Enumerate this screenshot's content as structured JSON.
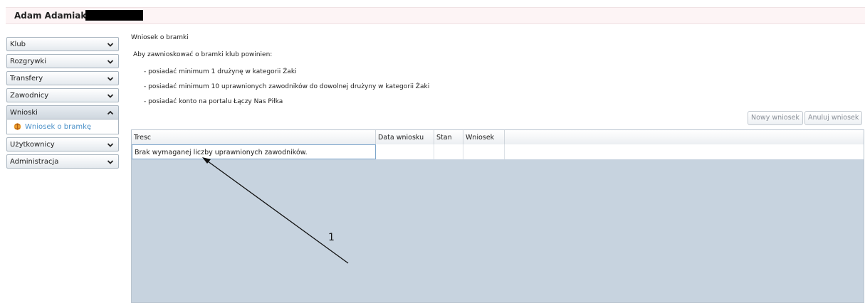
{
  "header": {
    "user_name": "Adam Adamiak,"
  },
  "menu": {
    "items": [
      {
        "label": "Klub",
        "icon": "chevron-down-icon"
      },
      {
        "label": "Rozgrywki",
        "icon": "chevron-down-icon"
      },
      {
        "label": "Transfery",
        "icon": "chevron-down-icon"
      },
      {
        "label": "Zawodnicy",
        "icon": "chevron-down-icon"
      },
      {
        "label": "Wnioski",
        "icon": "chevron-up-icon"
      },
      {
        "label": "Użytkownicy",
        "icon": "chevron-down-icon"
      },
      {
        "label": "Administracja",
        "icon": "chevron-down-icon"
      }
    ],
    "submenu": {
      "label": "Wniosek o bramkę",
      "icon": "goal-icon"
    }
  },
  "content": {
    "title": "Wniosek o bramki",
    "requirements_intro": "Aby zawnioskować o bramki klub powinien:",
    "requirements": [
      "- posiadać minimum 1 drużynę w kategorii Żaki",
      "- posiadać minimum 10 uprawnionych zawodników do dowolnej drużyny w kategorii Żaki",
      "- posiadać konto na portalu Łączy Nas Piłka"
    ],
    "buttons": {
      "new": "Nowy wniosek",
      "cancel": "Anuluj wniosek"
    }
  },
  "grid": {
    "columns": [
      "Tresc",
      "Data wniosku",
      "Stan",
      "Wniosek"
    ],
    "rows": [
      {
        "tresc": "Brak wymaganej liczby uprawnionych zawodników.",
        "data": "",
        "stan": "",
        "wniosek": ""
      }
    ]
  },
  "annotation": {
    "label": "1"
  },
  "colors": {
    "link": "#4a90c8",
    "grid_bg": "#c7d3df",
    "header_bg": "#fdf4f5"
  }
}
